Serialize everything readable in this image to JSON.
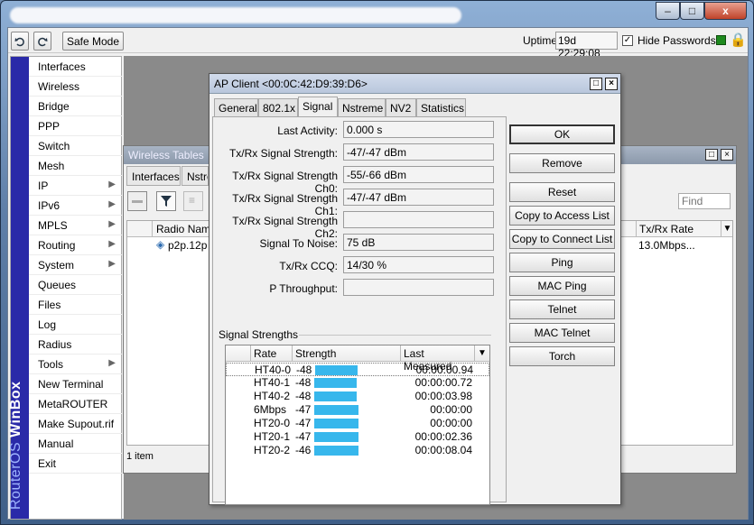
{
  "window": {
    "close": "x",
    "maximize": "□",
    "minimize": "–"
  },
  "toolbar": {
    "undo_icon": "undo-icon",
    "redo_icon": "redo-icon",
    "safe_mode": "Safe Mode",
    "uptime_label": "Uptime:",
    "uptime_value": "19d 22:29:08",
    "hide_passwords": "Hide Passwords",
    "hide_passwords_checked": true
  },
  "sidebar": {
    "brand_a": "RouterOS",
    "brand_b": "WinBox",
    "items": [
      {
        "label": "Interfaces",
        "sub": false
      },
      {
        "label": "Wireless",
        "sub": false
      },
      {
        "label": "Bridge",
        "sub": false
      },
      {
        "label": "PPP",
        "sub": false
      },
      {
        "label": "Switch",
        "sub": false
      },
      {
        "label": "Mesh",
        "sub": false
      },
      {
        "label": "IP",
        "sub": true
      },
      {
        "label": "IPv6",
        "sub": true
      },
      {
        "label": "MPLS",
        "sub": true
      },
      {
        "label": "Routing",
        "sub": true
      },
      {
        "label": "System",
        "sub": true
      },
      {
        "label": "Queues",
        "sub": false
      },
      {
        "label": "Files",
        "sub": false
      },
      {
        "label": "Log",
        "sub": false
      },
      {
        "label": "Radius",
        "sub": false
      },
      {
        "label": "Tools",
        "sub": true
      },
      {
        "label": "New Terminal",
        "sub": false
      },
      {
        "label": "MetaROUTER",
        "sub": false
      },
      {
        "label": "Make Supout.rif",
        "sub": false
      },
      {
        "label": "Manual",
        "sub": false
      },
      {
        "label": "Exit",
        "sub": false
      }
    ]
  },
  "wireless_tables": {
    "title": "Wireless Tables",
    "tabs": [
      "Interfaces",
      "Nstre"
    ],
    "find_placeholder": "Find",
    "col_radio_name": "Radio Name",
    "col_txrx_rate": "Tx/Rx Rate",
    "row_radio": "p2p.12p",
    "row_rate": "13.0Mbps...",
    "status": "1 item"
  },
  "dialog": {
    "title": "AP Client <00:0C:42:D9:39:D6>",
    "tabs": [
      "General",
      "802.1x",
      "Signal",
      "Nstreme",
      "NV2",
      "Statistics"
    ],
    "active_tab": "Signal",
    "fields": [
      {
        "label": "Last Activity:",
        "value": "0.000 s"
      },
      {
        "label": "Tx/Rx Signal Strength:",
        "value": "-47/-47 dBm"
      },
      {
        "label": "Tx/Rx Signal Strength Ch0:",
        "value": "-55/-66 dBm"
      },
      {
        "label": "Tx/Rx Signal Strength Ch1:",
        "value": "-47/-47 dBm"
      },
      {
        "label": "Tx/Rx Signal Strength Ch2:",
        "value": ""
      },
      {
        "label": "Signal To Noise:",
        "value": "75 dB"
      },
      {
        "label": "Tx/Rx CCQ:",
        "value": "14/30 %"
      },
      {
        "label": "P Throughput:",
        "value": ""
      }
    ],
    "group_label": "Signal Strengths",
    "table": {
      "headers": [
        "Rate",
        "Strength",
        "Last Measured"
      ],
      "rows": [
        {
          "rate": "HT40-0",
          "strength": "-48",
          "measured": "00:00:00.94",
          "level": 0.74
        },
        {
          "rate": "HT40-1",
          "strength": "-48",
          "measured": "00:00:00.72",
          "level": 0.74
        },
        {
          "rate": "HT40-2",
          "strength": "-48",
          "measured": "00:00:03.98",
          "level": 0.74
        },
        {
          "rate": "6Mbps",
          "strength": "-47",
          "measured": "00:00:00",
          "level": 0.77
        },
        {
          "rate": "HT20-0",
          "strength": "-47",
          "measured": "00:00:00",
          "level": 0.77
        },
        {
          "rate": "HT20-1",
          "strength": "-47",
          "measured": "00:00:02.36",
          "level": 0.77
        },
        {
          "rate": "HT20-2",
          "strength": "-46",
          "measured": "00:00:08.04",
          "level": 0.77
        }
      ]
    },
    "buttons": [
      "OK",
      "Remove",
      "Reset",
      "Copy to Access List",
      "Copy to Connect List",
      "Ping",
      "MAC Ping",
      "Telnet",
      "MAC Telnet",
      "Torch"
    ]
  }
}
